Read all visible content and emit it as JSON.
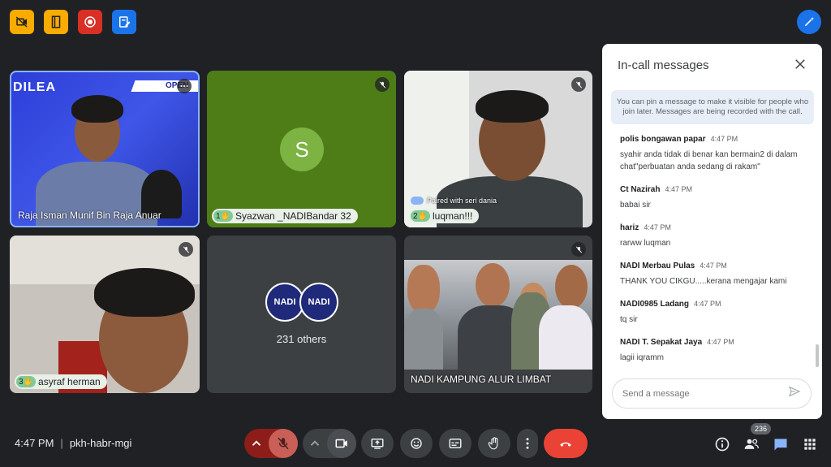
{
  "top_icons": [
    "camera-off-icon",
    "door-exit-icon",
    "record-icon",
    "notes-edit-icon"
  ],
  "tiles": [
    {
      "name": "Raja Isman Munif Bin Raja Anuar",
      "logo_text": "DILEA",
      "banner_text": "OPEN"
    },
    {
      "initial": "S",
      "hand_number": "1",
      "name": "Syazwan _NADIBandar 32"
    },
    {
      "hand_number": "2",
      "name": "luqman!!!",
      "paired": "Paired with seri dania"
    },
    {
      "hand_number": "3",
      "name": "asyraf herman"
    },
    {
      "others": "231 others",
      "logo_text": "NADI"
    },
    {
      "name": "NADI KAMPUNG ALUR LIMBAT"
    }
  ],
  "panel": {
    "title": "In-call messages",
    "notice": "You can pin a message to make it visible for people who join later. Messages are being recorded with the call.",
    "messages": [
      {
        "sender": "polis bongawan papar",
        "time": "4:47 PM",
        "text": "syahir anda tidak di benar kan bermain2 di dalam chat\"perbuatan anda sedang di rakam\""
      },
      {
        "sender": "Ct Nazirah",
        "time": "4:47 PM",
        "text": "babai sir"
      },
      {
        "sender": "hariz",
        "time": "4:47 PM",
        "text": "rarww luqman"
      },
      {
        "sender": "NADI Merbau Pulas",
        "time": "4:47 PM",
        "text": "THANK YOU CIKGU.....kerana mengajar kami"
      },
      {
        "sender": "NADI0985 Ladang",
        "time": "4:47 PM",
        "text": "tq sir"
      },
      {
        "sender": "NADI T. Sepakat Jaya",
        "time": "4:47 PM",
        "text": "lagii iqramm"
      }
    ],
    "input_placeholder": "Send a message"
  },
  "bottom": {
    "time": "4:47 PM",
    "meeting_code": "pkh-habr-mgi",
    "participants_count": "236"
  },
  "colors": {
    "background": "#202124",
    "end_call": "#ea4335",
    "chat_active": "#8ab4f8"
  }
}
